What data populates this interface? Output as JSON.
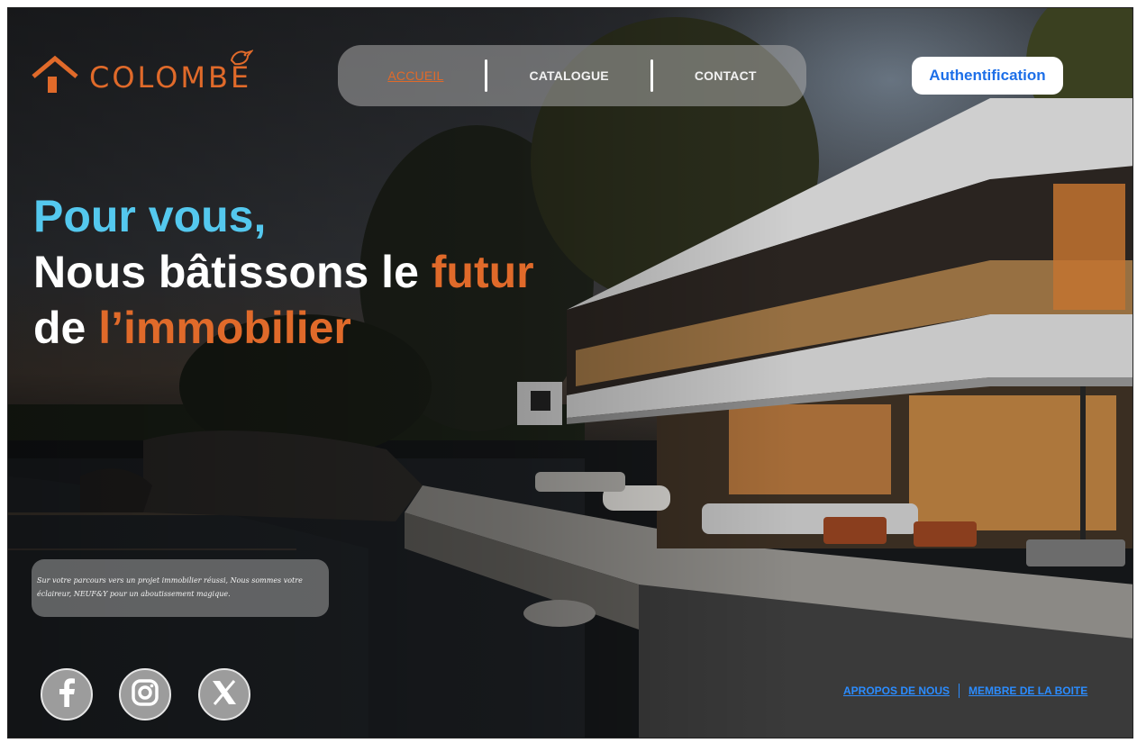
{
  "brand": {
    "name": "COLOMBE",
    "accent_color": "#e06a2a",
    "logo_icons": [
      "house-icon",
      "bird-icon"
    ]
  },
  "nav": {
    "items": [
      {
        "label": "ACCUEIL",
        "active": true
      },
      {
        "label": "CATALOGUE",
        "active": false
      },
      {
        "label": "CONTACT",
        "active": false
      }
    ]
  },
  "auth": {
    "label": "Authentification",
    "text_color": "#1d6fe8"
  },
  "hero": {
    "line1": "Pour vous,",
    "line2_white": "Nous bâtissons le ",
    "line2_orange": "futur",
    "line3_white": "de ",
    "line3_orange": "l’immobilier",
    "line1_color": "#54c8ee"
  },
  "tagline": {
    "text": "Sur votre parcours vers un projet immobilier réussi, Nous sommes votre éclaireur, NEUF&Y pour un aboutissement magique."
  },
  "socials": [
    {
      "icon": "facebook-icon"
    },
    {
      "icon": "instagram-icon"
    },
    {
      "icon": "x-icon"
    }
  ],
  "footer": {
    "links": [
      "APROPOS DE NOUS",
      "MEMBRE DE LA BOITE"
    ],
    "link_color": "#2b8cff"
  }
}
